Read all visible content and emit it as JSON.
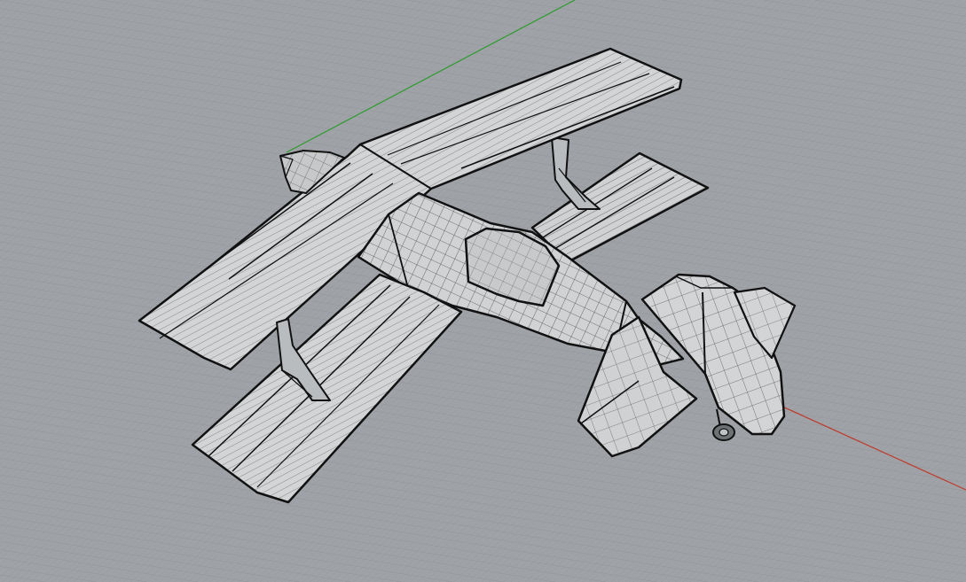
{
  "viewport": {
    "grid": true,
    "axes": [
      {
        "name": "x-axis",
        "color": "#c0392b"
      },
      {
        "name": "y-axis",
        "color": "#2e9b2e"
      }
    ],
    "display_mode": "shaded-with-wireframe",
    "background_color": "#9fa2a6",
    "grid_color": "#8e9196",
    "model_fill_color": "#d2d4d6",
    "model_shadow_color": "#b9bcbf",
    "model_edge_color": "#111111"
  }
}
